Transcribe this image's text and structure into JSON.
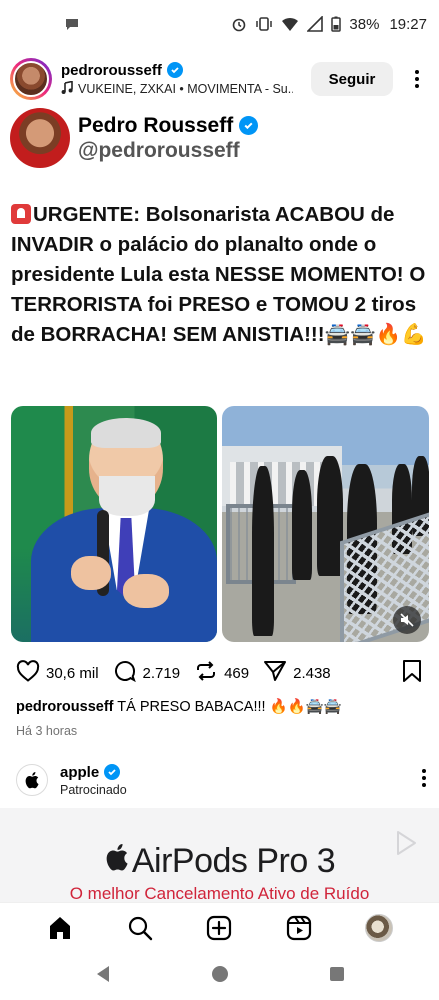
{
  "status_bar": {
    "battery": "38%",
    "time": "19:27",
    "icons": [
      "chat-bubble-icon",
      "alarm-icon",
      "vibrate-icon",
      "wifi-icon",
      "signal-icon",
      "battery-icon"
    ]
  },
  "post": {
    "username": "pedrorousseff",
    "music": "VUKEINE, ZXKAI • MOVIMENTA - Su...",
    "follow_label": "Seguir",
    "tweet": {
      "name": "Pedro Rousseff",
      "handle": "@pedrorousseff",
      "text_main": "URGENTE: Bolsonarista ACABOU de INVADIR o palácio do planalto onde o presidente Lula esta NESSE MOMENTO! O TERRORISTA foi PRESO e TOMOU 2 tiros de BORRACHA! SEM ANISTIA!!!",
      "text_emojis": "🚔🚔🔥💪"
    },
    "likes": "30,6 mil",
    "comments": "2.719",
    "reposts": "469",
    "shares": "2.438",
    "caption_user": "pedrorousseff",
    "caption_text": "TÁ PRESO BABACA!!! 🔥🔥🚔🚔",
    "time_ago": "Há 3 horas"
  },
  "sponsored": {
    "name": "apple",
    "label": "Patrocinado",
    "ad_title": "AirPods Pro 3",
    "ad_subtitle": "O melhor Cancelamento Ativo de Ruído"
  },
  "colors": {
    "verified": "#0095f6",
    "ad_red": "#d0243a"
  }
}
